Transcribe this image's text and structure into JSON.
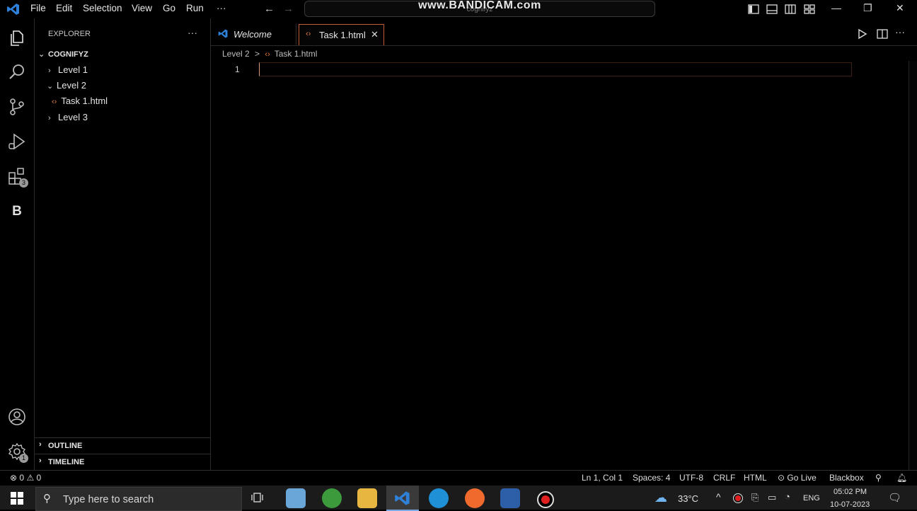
{
  "titlebar": {
    "menu": [
      "File",
      "Edit",
      "Selection",
      "View",
      "Go",
      "Run",
      "···"
    ],
    "command_center_text": "cognifyz",
    "watermark": "www.BANDICAM.com"
  },
  "activity_bar": {
    "extensions_badge": "3",
    "settings_badge": "1",
    "blackbox_label": "B"
  },
  "sidebar": {
    "title": "EXPLORER",
    "more": "···",
    "root": "COGNIFYZ",
    "items": [
      "Level 1",
      "Level 2",
      "Task 1.html",
      "Level 3"
    ],
    "outline": "OUTLINE",
    "timeline": "TIMELINE"
  },
  "tabs": {
    "welcome": "Welcome",
    "task": "Task 1.html",
    "close": "✕"
  },
  "breadcrumb": {
    "folder": "Level 2",
    "separator": ">",
    "file": "Task 1.html"
  },
  "editor": {
    "line_number": "1"
  },
  "statusbar": {
    "errors": "0",
    "warnings": "0",
    "position": "Ln 1, Col 1",
    "spaces": "Spaces: 4",
    "encoding": "UTF-8",
    "eol": "CRLF",
    "language": "HTML",
    "golive": "Go Live",
    "blackbox": "Blackbox"
  },
  "taskbar": {
    "search_placeholder": "Type here to search",
    "temperature": "33°C",
    "language": "ENG",
    "time": "05:02 PM",
    "date": "10-07-2023"
  },
  "colors": {
    "accent": "#c35a38",
    "html_icon": "#e57c3c",
    "vscode_blue": "#2f80d8"
  }
}
